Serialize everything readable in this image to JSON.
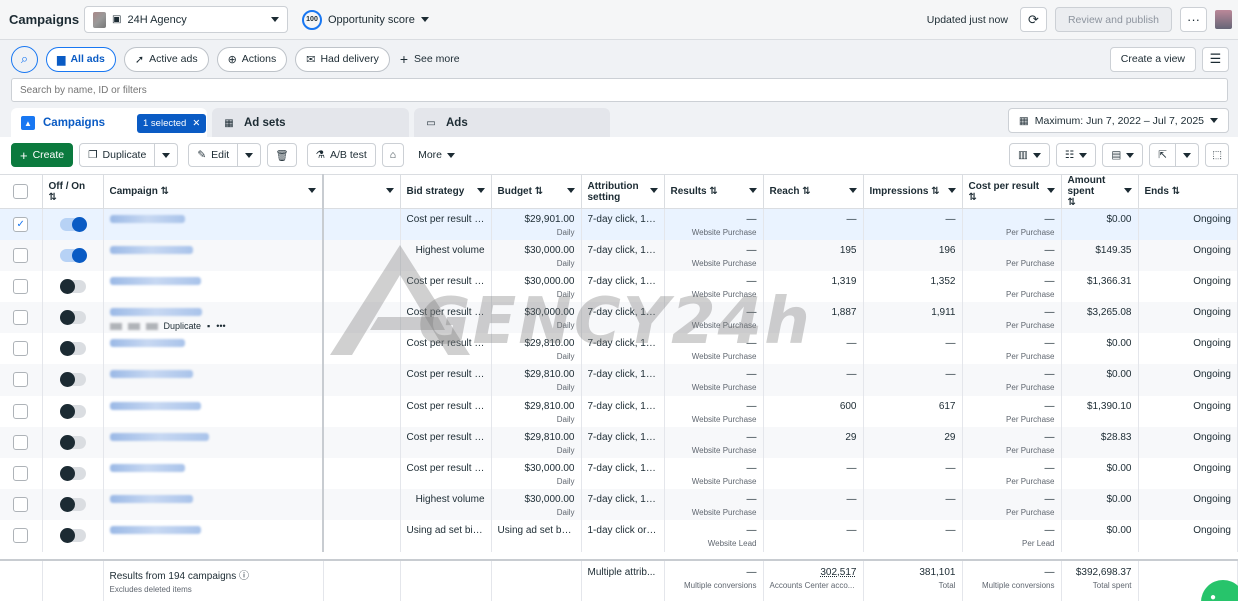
{
  "header": {
    "title": "Campaigns",
    "account_name": "24H Agency",
    "opportunity_score_value": "100",
    "opportunity_score_label": "Opportunity score",
    "updated_text": "Updated just now",
    "review_publish_label": "Review and publish",
    "more_label": "···"
  },
  "filters": {
    "chips": [
      "All ads",
      "Active ads",
      "Actions",
      "Had delivery"
    ],
    "see_more": "See more",
    "create_view": "Create a view",
    "search_placeholder": "Search by name, ID or filters"
  },
  "tabs": {
    "campaigns": "Campaigns",
    "selected_chip": "1 selected",
    "ad_sets": "Ad sets",
    "ads": "Ads",
    "date_range": "Maximum: Jun 7, 2022 – Jul 7, 2025"
  },
  "toolbar": {
    "create": "Create",
    "duplicate": "Duplicate",
    "edit": "Edit",
    "ab_test": "A/B test",
    "more": "More"
  },
  "columns": {
    "offon": "Off / On",
    "campaign": "Campaign",
    "bid": "Bid strategy",
    "budget": "Budget",
    "attr": "Attribution setting",
    "results": "Results",
    "reach": "Reach",
    "impressions": "Impressions",
    "cpr": "Cost per result",
    "amount": "Amount spent",
    "ends": "Ends"
  },
  "row_hover_action": "Duplicate",
  "rows": [
    {
      "selected": true,
      "on": true,
      "bid": "Cost per result g...",
      "bid_align": "left",
      "budget": "$29,901.00",
      "budget_sub": "Daily",
      "attr": "7-day click, 1-...",
      "results": "—",
      "results_sub": "Website Purchase",
      "reach": "—",
      "impressions": "—",
      "cpr": "—",
      "cpr_sub": "Per Purchase",
      "amount": "$0.00",
      "ends": "Ongoing"
    },
    {
      "selected": false,
      "on": true,
      "bid": "Highest volume",
      "bid_align": "right",
      "budget": "$30,000.00",
      "budget_sub": "Daily",
      "attr": "7-day click, 1-...",
      "results": "—",
      "results_sub": "Website Purchase",
      "reach": "195",
      "impressions": "196",
      "cpr": "—",
      "cpr_sub": "Per Purchase",
      "amount": "$149.35",
      "ends": "Ongoing"
    },
    {
      "selected": false,
      "on": false,
      "bid": "Cost per result g...",
      "bid_align": "left",
      "budget": "$30,000.00",
      "budget_sub": "Daily",
      "attr": "7-day click, 1-...",
      "results": "—",
      "results_sub": "Website Purchase",
      "reach": "1,319",
      "impressions": "1,352",
      "cpr": "—",
      "cpr_sub": "Per Purchase",
      "amount": "$1,366.31",
      "ends": "Ongoing"
    },
    {
      "selected": false,
      "on": false,
      "hover": true,
      "bid": "Cost per result g...",
      "bid_align": "left",
      "budget": "$30,000.00",
      "budget_sub": "Daily",
      "attr": "7-day click, 1-...",
      "results": "—",
      "results_sub": "Website Purchase",
      "reach": "1,887",
      "impressions": "1,911",
      "cpr": "—",
      "cpr_sub": "Per Purchase",
      "amount": "$3,265.08",
      "ends": "Ongoing"
    },
    {
      "selected": false,
      "on": false,
      "bid": "Cost per result g...",
      "bid_align": "left",
      "budget": "$29,810.00",
      "budget_sub": "Daily",
      "attr": "7-day click, 1-...",
      "results": "—",
      "results_sub": "Website Purchase",
      "reach": "—",
      "impressions": "—",
      "cpr": "—",
      "cpr_sub": "Per Purchase",
      "amount": "$0.00",
      "ends": "Ongoing"
    },
    {
      "selected": false,
      "on": false,
      "bid": "Cost per result g...",
      "bid_align": "left",
      "budget": "$29,810.00",
      "budget_sub": "Daily",
      "attr": "7-day click, 1-...",
      "results": "—",
      "results_sub": "Website Purchase",
      "reach": "—",
      "impressions": "—",
      "cpr": "—",
      "cpr_sub": "Per Purchase",
      "amount": "$0.00",
      "ends": "Ongoing"
    },
    {
      "selected": false,
      "on": false,
      "bid": "Cost per result g...",
      "bid_align": "left",
      "budget": "$29,810.00",
      "budget_sub": "Daily",
      "attr": "7-day click, 1-...",
      "results": "—",
      "results_sub": "Website Purchase",
      "reach": "600",
      "impressions": "617",
      "cpr": "—",
      "cpr_sub": "Per Purchase",
      "amount": "$1,390.10",
      "ends": "Ongoing"
    },
    {
      "selected": false,
      "on": false,
      "bid": "Cost per result g...",
      "bid_align": "left",
      "budget": "$29,810.00",
      "budget_sub": "Daily",
      "attr": "7-day click, 1-...",
      "results": "—",
      "results_sub": "Website Purchase",
      "reach": "29",
      "impressions": "29",
      "cpr": "—",
      "cpr_sub": "Per Purchase",
      "amount": "$28.83",
      "ends": "Ongoing"
    },
    {
      "selected": false,
      "on": false,
      "bid": "Cost per result g...",
      "bid_align": "left",
      "budget": "$30,000.00",
      "budget_sub": "Daily",
      "attr": "7-day click, 1-...",
      "results": "—",
      "results_sub": "Website Purchase",
      "reach": "—",
      "impressions": "—",
      "cpr": "—",
      "cpr_sub": "Per Purchase",
      "amount": "$0.00",
      "ends": "Ongoing"
    },
    {
      "selected": false,
      "on": false,
      "bid": "Highest volume",
      "bid_align": "right",
      "budget": "$30,000.00",
      "budget_sub": "Daily",
      "attr": "7-day click, 1-...",
      "results": "—",
      "results_sub": "Website Purchase",
      "reach": "—",
      "impressions": "—",
      "cpr": "—",
      "cpr_sub": "Per Purchase",
      "amount": "$0.00",
      "ends": "Ongoing"
    },
    {
      "selected": false,
      "on": false,
      "bid": "Using ad set bid ...",
      "bid_align": "left",
      "budget": "Using ad set bud...",
      "budget_sub": "",
      "attr": "1-day click or ...",
      "results": "—",
      "results_sub": "Website Lead",
      "reach": "—",
      "impressions": "—",
      "cpr": "—",
      "cpr_sub": "Per Lead",
      "amount": "$0.00",
      "ends": "Ongoing"
    }
  ],
  "footer": {
    "results_label": "Results from 194 campaigns",
    "results_sub": "Excludes deleted items",
    "attr": "Multiple attrib...",
    "results": "—",
    "results_sub2": "Multiple conversions",
    "reach": "302,517",
    "reach_sub": "Accounts Center acco...",
    "impressions": "381,101",
    "impressions_sub": "Total",
    "cpr": "—",
    "cpr_sub": "Multiple conversions",
    "amount": "$392,698.37",
    "amount_sub": "Total spent"
  },
  "watermark": "GENCY24h"
}
